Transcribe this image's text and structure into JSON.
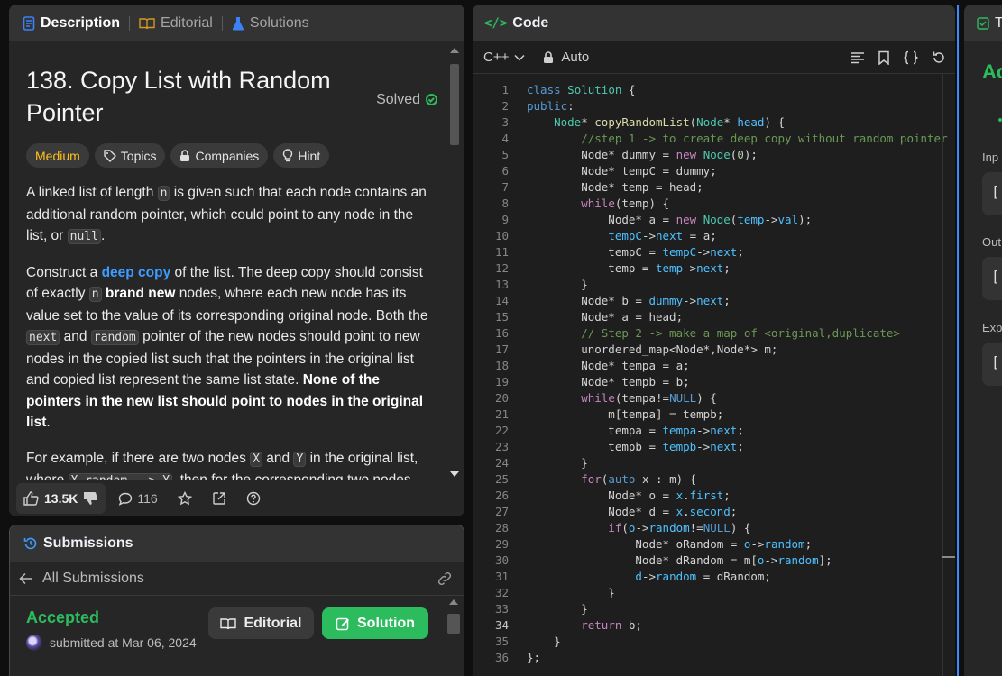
{
  "left_tabs": [
    "Description",
    "Editorial",
    "Solutions"
  ],
  "problem": {
    "title": "138. Copy List with Random Pointer",
    "status": "Solved",
    "difficulty": "Medium",
    "chips": [
      "Topics",
      "Companies",
      "Hint"
    ],
    "p1_a": "A linked list of length ",
    "p1_code1": "n",
    "p1_b": " is given such that each node contains an additional random pointer, which could point to any node in the list, or ",
    "p1_code2": "null",
    "p1_c": ".",
    "p2_a": "Construct a ",
    "p2_link": "deep copy",
    "p2_b": " of the list. The deep copy should consist of exactly ",
    "p2_code1": "n",
    "p2_bold1": "brand new",
    "p2_c": " nodes, where each new node has its value set to the value of its corresponding original node. Both the ",
    "p2_code2": "next",
    "p2_d": " and ",
    "p2_code3": "random",
    "p2_e": " pointer of the new nodes should point to new nodes in the copied list such that the pointers in the original list and copied list represent the same list state. ",
    "p2_bold2": "None of the pointers in the new list should point to nodes in the original list",
    "p2_f": ".",
    "p3_a": "For example, if there are two nodes ",
    "p3_code1": "X",
    "p3_b": " and ",
    "p3_code2": "Y",
    "p3_c": " in the original list, where ",
    "p3_code3": "X.random --> Y",
    "p3_d": ", then for the corresponding two nodes"
  },
  "footer": {
    "likes": "13.5K",
    "comments": "116"
  },
  "submissions": {
    "title": "Submissions",
    "back_label": "All Submissions",
    "status": "Accepted",
    "submitted": "submitted at Mar 06, 2024",
    "editorial_btn": "Editorial",
    "solution_btn": "Solution"
  },
  "code_panel": {
    "title": "Code",
    "language": "C++",
    "mode": "Auto",
    "current_line": 34
  },
  "right_panel": {
    "tab": "T",
    "status": "Ac",
    "labels": [
      "Inp",
      "Out",
      "Exp"
    ]
  },
  "colors": {
    "accent_green": "#2cbb5d",
    "medium": "#ffc01e",
    "link": "#3b9dff"
  }
}
